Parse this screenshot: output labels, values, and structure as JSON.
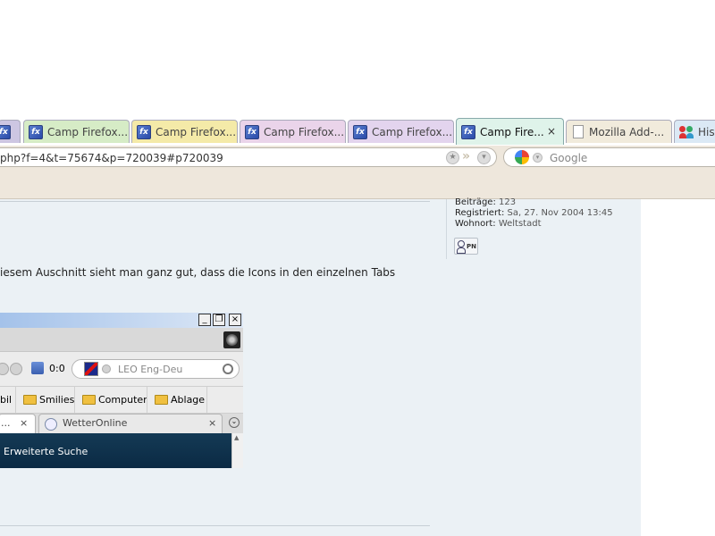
{
  "tabs": [
    {
      "label": "",
      "icon": "partial-tab-icon",
      "color": "#cdc6e2"
    },
    {
      "label": "Camp Firefox...",
      "icon": "firefox-page-icon",
      "color": "#d6ecc6"
    },
    {
      "label": "Camp Firefox...",
      "icon": "firefox-page-icon",
      "color": "#f4eaa8"
    },
    {
      "label": "Camp Firefox...",
      "icon": "firefox-page-icon",
      "color": "#ead4ea"
    },
    {
      "label": "Camp Firefox...",
      "icon": "firefox-page-icon",
      "color": "#e3d4ee"
    },
    {
      "label": "Camp Fire...",
      "icon": "firefox-page-icon",
      "color": "#dff3ea",
      "active": true,
      "close": "×"
    },
    {
      "label": "Mozilla Add-...",
      "icon": "document-icon",
      "color": "#f1ebdc"
    },
    {
      "label": "His",
      "icon": "people-icon",
      "color": "#dbe9f5"
    }
  ],
  "nav": {
    "url": "php?f=4&t=75674&p=720039#p720039",
    "search_placeholder": "Google",
    "star_icon": "star-icon",
    "dropdown_icon": "chevron-down-icon",
    "go_icon": "go-arrow-icon"
  },
  "profile": {
    "posts_label": "Beiträge:",
    "posts_value": "123",
    "registered_label": "Registriert:",
    "registered_value": "Sa, 27. Nov 2004 13:45",
    "location_label": "Wohnort:",
    "location_value": "Weltstadt",
    "pm_label": "PN"
  },
  "post": {
    "text": "iesem Auschnitt sieht man ganz gut, dass die Icons in den einzelnen Tabs"
  },
  "screenshot": {
    "window_buttons": [
      "_",
      "❐",
      "×"
    ],
    "counter": "0:0",
    "search_placeholder": "LEO Eng-Deu",
    "bookmarks": [
      "bil",
      "Smilies",
      "Computer",
      "Ablage"
    ],
    "tabs": [
      {
        "label": "...",
        "close": "×"
      },
      {
        "label": "WetterOnline",
        "close": "×"
      }
    ],
    "tab_list_icon": "⌄",
    "scroll_up": "▲",
    "content_text": "Erweiterte Suche"
  },
  "colors": {
    "toolbar": "#eee7dc",
    "page_background": "#ebf1f5",
    "embedded_content": "#0b2a44"
  }
}
